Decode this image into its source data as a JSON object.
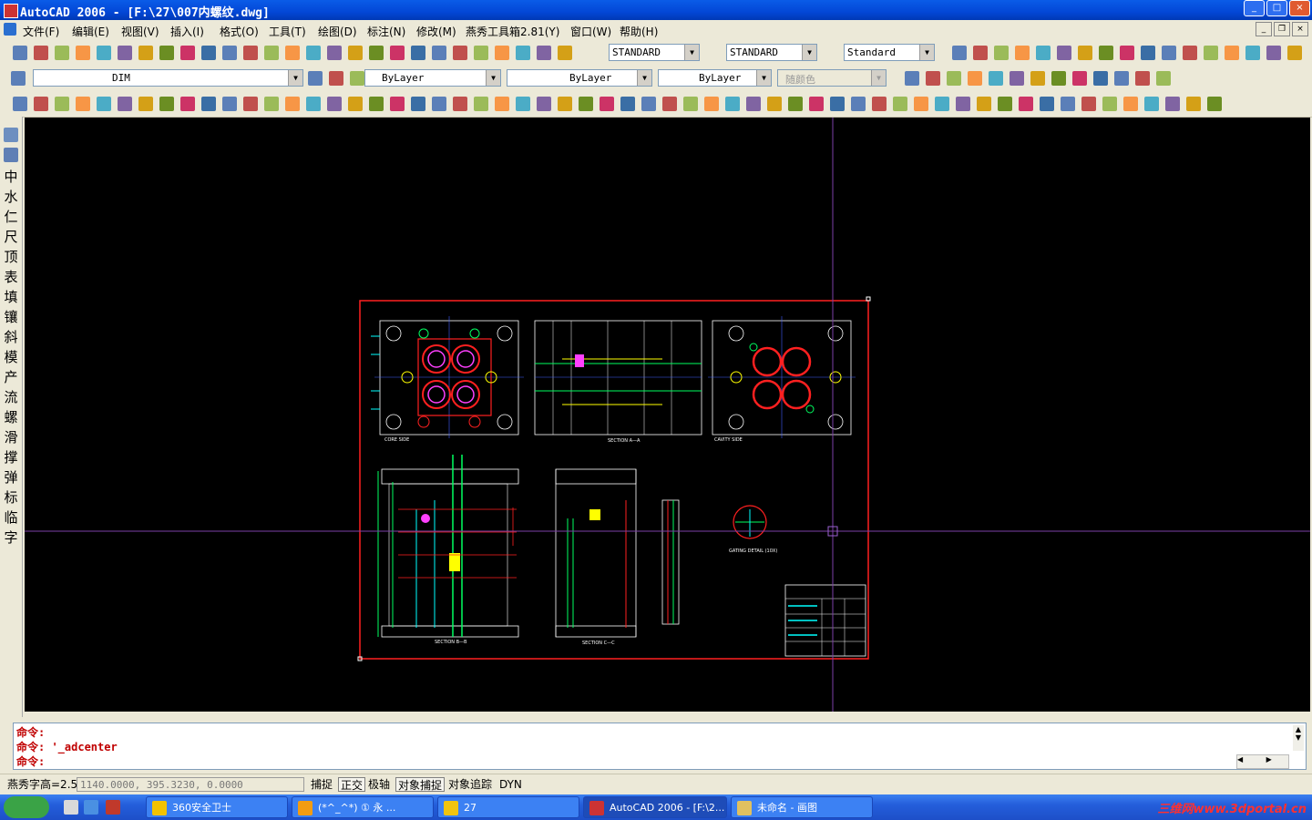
{
  "window": {
    "title": "AutoCAD 2006 - [F:\\27\\007内螺纹.dwg]",
    "min": "_",
    "max": "□",
    "close": "×"
  },
  "menu": [
    "文件(F)",
    "编辑(E)",
    "视图(V)",
    "插入(I)",
    "格式(O)",
    "工具(T)",
    "绘图(D)",
    "标注(N)",
    "修改(M)",
    "燕秀工具箱2.81(Y)",
    "窗口(W)",
    "帮助(H)"
  ],
  "styles": {
    "text_style": "STANDARD",
    "dim_style": "STANDARD",
    "table_style": "Standard"
  },
  "layers": {
    "current_layer": "DIM",
    "color": "ByLayer",
    "linetype": "ByLayer",
    "lineweight": "ByLayer",
    "plot_style": "随颜色"
  },
  "left_tools": [
    "中",
    "水",
    "仁",
    "尺",
    "顶",
    "表",
    "填",
    "镶",
    "斜",
    "模",
    "产",
    "流",
    "螺",
    "滑",
    "撑",
    "弹",
    "标",
    "临",
    "字"
  ],
  "drawing_labels": {
    "core_side": "CORE SIDE",
    "section_aa": "SECTION A—A",
    "cavity_side": "CAVITY SIDE",
    "section_bb": "SECTION B—B",
    "section_cc": "SECTION C—C",
    "gating_detail": "GATING DETAIL (10X)"
  },
  "command": {
    "line1": "命令:",
    "line2": "命令: '_adcenter",
    "line3": "命令:"
  },
  "status": {
    "left_label": "燕秀字高=2.5",
    "coords": "1140.0000,  395.3230,  0.0000",
    "toggles": [
      "捕捉",
      "正交",
      "极轴",
      "对象捕捉",
      "对象追踪",
      "DYN"
    ],
    "toggles_on": [
      false,
      true,
      false,
      true,
      false,
      false
    ]
  },
  "taskbar": {
    "items": [
      "360安全卫士",
      "(*^_^*) ① 永 ...",
      "27",
      "AutoCAD 2006 - [F:\\2...",
      "未命名 - 画图"
    ],
    "watermark": "三维网www.3dportal.cn"
  },
  "colors": {
    "titlebar": "#0347d6",
    "canvas_bg": "#000000",
    "cmd_text": "#c00000",
    "crosshair": "#7d3fa8"
  }
}
